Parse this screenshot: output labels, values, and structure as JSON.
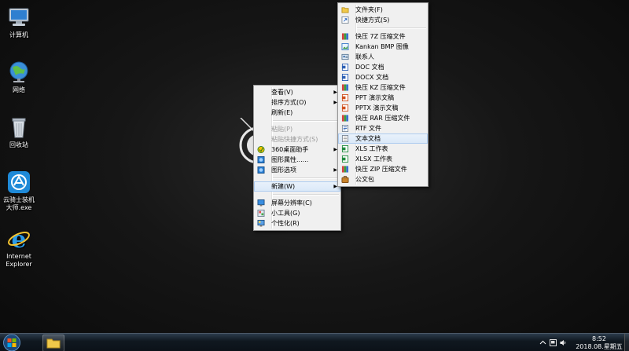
{
  "desktop_icons": [
    {
      "name": "computer",
      "label": "计算机"
    },
    {
      "name": "network",
      "label": "网络"
    },
    {
      "name": "recycle-bin",
      "label": "回收站"
    },
    {
      "name": "yunqishi",
      "label_line1": "云骑士装机",
      "label_line2": "大师.exe"
    },
    {
      "name": "ie",
      "label_line1": "Internet",
      "label_line2": "Explorer"
    }
  ],
  "context_menu": {
    "view": "查看(V)",
    "sort": "排序方式(O)",
    "refresh": "刷新(E)",
    "paste": "粘贴(P)",
    "paste_shortcut": "粘贴快捷方式(S)",
    "desk_assistant": "360桌面助手",
    "graphics_properties": "图形属性......",
    "graphics_options": "图形选项",
    "new": "新建(W)",
    "screen_resolution": "屏幕分辨率(C)",
    "gadgets": "小工具(G)",
    "personalize": "个性化(R)"
  },
  "new_submenu": {
    "folder": "文件夹(F)",
    "shortcut": "快捷方式(S)",
    "z7": "快压 7Z 压缩文件",
    "bmp": "Kankan BMP 图像",
    "contact": "联系人",
    "doc": "DOC 文档",
    "docx": "DOCX 文档",
    "kz": "快压 KZ 压缩文件",
    "ppt": "PPT 演示文稿",
    "pptx": "PPTX 演示文稿",
    "rar": "快压 RAR 压缩文件",
    "rtf": "RTF 文件",
    "txt": "文本文档",
    "xls": "XLS 工作表",
    "xlsx": "XLSX 工作表",
    "zip": "快压 ZIP 压缩文件",
    "briefcase": "公文包"
  },
  "taskbar": {
    "time": "8:52",
    "date": "2018.08.星期五"
  },
  "colors": {
    "menu_bg": "#f0f0f0",
    "highlight": "#d9e8f8",
    "taskbar": "#101820"
  }
}
